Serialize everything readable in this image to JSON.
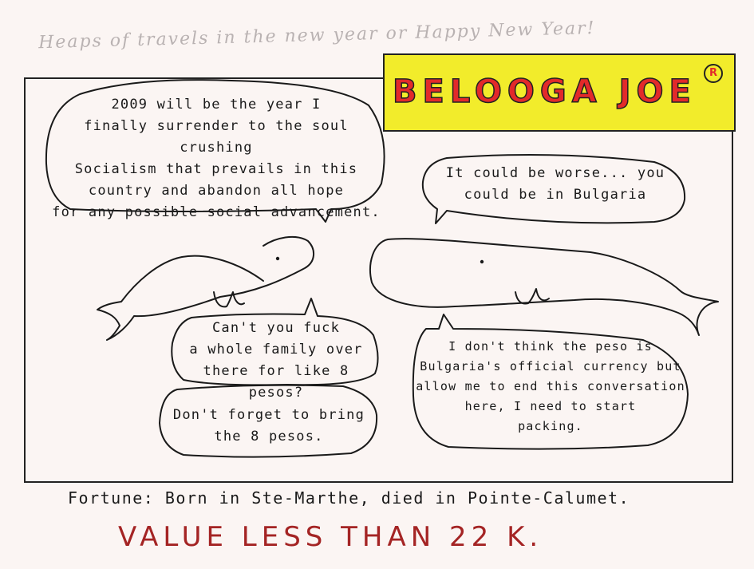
{
  "header_note": "Heaps of travels in the new year or Happy New Year!",
  "title": {
    "text": "BELOOGA JOE",
    "mark": "R"
  },
  "bubbles": {
    "top_left": "2009 will be the year I\nfinally surrender to the soul crushing\nSocialism that prevails in this\ncountry and abandon all hope\nfor any possible social advancement.",
    "top_right": "It could be worse... you\ncould be in Bulgaria",
    "middle_left": "Can't you fuck\na whole family over\nthere for like 8 pesos?",
    "bottom_left": "Don't forget to bring\nthe 8 pesos.",
    "bottom_right": "I don't think the peso is\nBulgaria's official currency but\nallow me to end this conversation\nhere, I need to start\npacking."
  },
  "footer": {
    "fortune": "Fortune: Born in Ste-Marthe, died in Pointe-Calumet.",
    "value": "VALUE LESS THAN 22 K."
  },
  "colors": {
    "paper": "#fbf5f3",
    "title_bg": "#f2ec2b",
    "title_text": "#e22a2a",
    "value_text": "#a42424"
  }
}
